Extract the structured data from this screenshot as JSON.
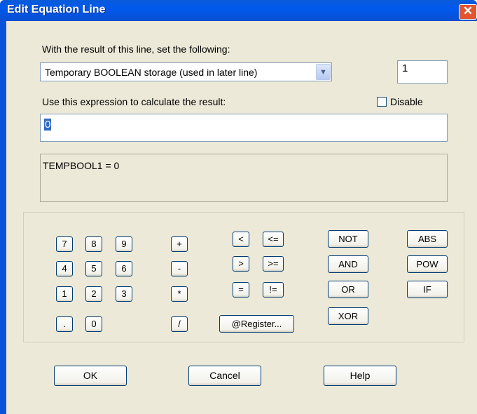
{
  "dialog": {
    "title": "Edit Equation Line",
    "close_glyph": "✕"
  },
  "labels": {
    "set_prompt": "With the result of this line, set the following:",
    "expr_prompt": "Use this expression to calculate the result:",
    "disable": "Disable"
  },
  "target_select": {
    "value": "Temporary BOOLEAN storage (used in later line)",
    "arrow": "▼"
  },
  "index_field": {
    "value": "1"
  },
  "disable_checkbox": {
    "checked": false
  },
  "expression_field": {
    "value": "0"
  },
  "result_preview": {
    "text": "TEMPBOOL1 = 0"
  },
  "keypad": {
    "digits": [
      "7",
      "8",
      "9",
      "4",
      "5",
      "6",
      "1",
      "2",
      "3",
      ".",
      "0"
    ],
    "arith": [
      "+",
      "-",
      "*",
      "/"
    ],
    "compare": [
      "<",
      "<=",
      ">",
      ">=",
      "=",
      "!="
    ],
    "register": "@Register...",
    "logic": [
      "NOT",
      "AND",
      "OR",
      "XOR"
    ],
    "functions": [
      "ABS",
      "POW",
      "IF"
    ]
  },
  "footer": {
    "ok": "OK",
    "cancel": "Cancel",
    "help": "Help"
  }
}
